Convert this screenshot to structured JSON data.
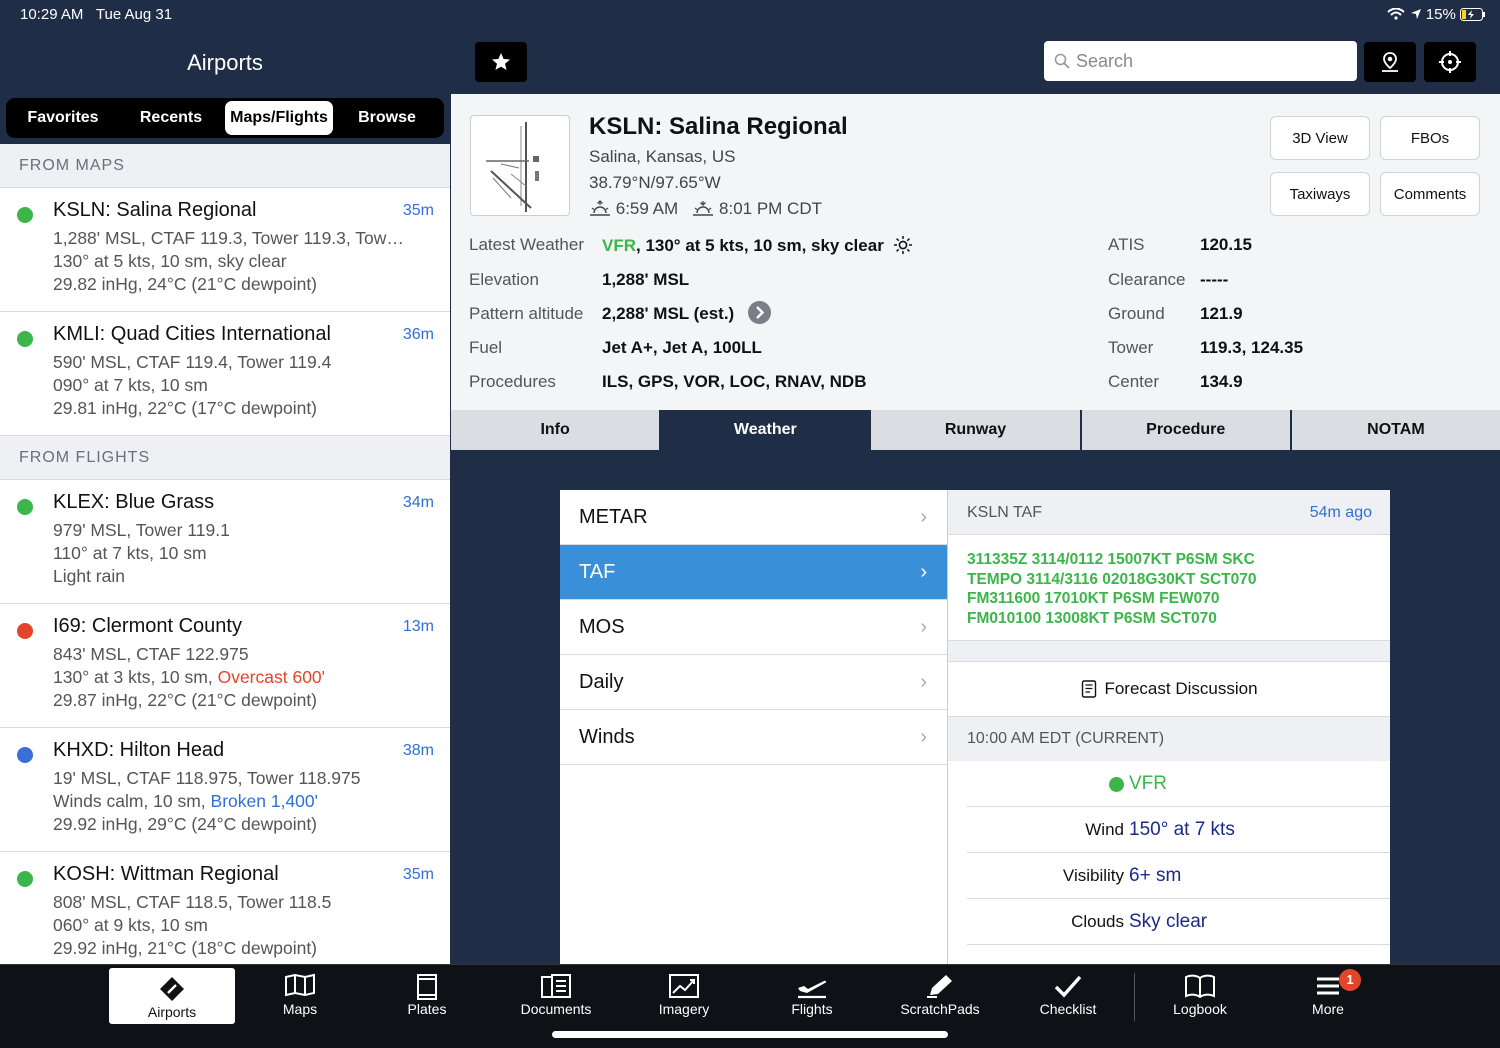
{
  "status": {
    "time": "10:29 AM",
    "date": "Tue Aug 31",
    "battery": "15%"
  },
  "left": {
    "title": "Airports",
    "segments": [
      "Favorites",
      "Recents",
      "Maps/Flights",
      "Browse"
    ],
    "section_maps": "FROM MAPS",
    "section_flights": "FROM FLIGHTS",
    "maps_airports": [
      {
        "name": "KSLN: Salina Regional",
        "age": "35m",
        "line1": "1,288' MSL, CTAF 119.3, Tower 119.3, Tow…",
        "line2": "130° at 5 kts, 10 sm, sky clear",
        "line3": "29.82 inHg, 24°C (21°C dewpoint)",
        "color": "#3cb64a"
      },
      {
        "name": "KMLI: Quad Cities International",
        "age": "36m",
        "line1": "590' MSL, CTAF 119.4, Tower 119.4",
        "line2": "090° at 7 kts, 10 sm",
        "line3": "29.81 inHg, 22°C (17°C dewpoint)",
        "color": "#3cb64a"
      }
    ],
    "flights_airports": [
      {
        "name": "KLEX: Blue Grass",
        "age": "34m",
        "line1": "979' MSL, Tower 119.1",
        "line2": "110° at 7 kts, 10 sm",
        "line3": "Light rain",
        "color": "#3cb64a"
      },
      {
        "name": "I69: Clermont County",
        "age": "13m",
        "line1": "843' MSL, CTAF 122.975",
        "line2a": "130° at 3 kts, 10 sm, ",
        "line2b": "Overcast 600'",
        "line3": "29.87 inHg, 22°C (21°C dewpoint)",
        "color": "#e2452b"
      },
      {
        "name": "KHXD: Hilton Head",
        "age": "38m",
        "line1": "19' MSL, CTAF 118.975, Tower 118.975",
        "line2a": "Winds calm, 10 sm, ",
        "line2b": "Broken 1,400'",
        "line3": "29.92 inHg, 29°C (24°C dewpoint)",
        "color": "#3a6fd8"
      },
      {
        "name": "KOSH: Wittman Regional",
        "age": "35m",
        "line1": "808' MSL, CTAF 118.5, Tower 118.5",
        "line2": "060° at 9 kts, 10 sm",
        "line3": "29.92 inHg, 21°C (18°C dewpoint)",
        "color": "#3cb64a"
      }
    ]
  },
  "header": {
    "search_placeholder": "Search",
    "star_icon": "star-icon",
    "pin_icon": "map-pin-icon",
    "locate_icon": "crosshair-icon"
  },
  "airport": {
    "title": "KSLN: Salina Regional",
    "location": "Salina, Kansas, US",
    "coords": "38.79°N/97.65°W",
    "sunrise": "6:59 AM",
    "sunset": "8:01 PM CDT",
    "buttons": {
      "view3d": "3D View",
      "fbos": "FBOs",
      "taxiways": "Taxiways",
      "comments": "Comments"
    },
    "weather_label": "Latest Weather",
    "weather_cat": "VFR",
    "weather_text": ", 130° at 5 kts, 10 sm, sky clear",
    "elev_label": "Elevation",
    "elev": "1,288' MSL",
    "pattern_label": "Pattern altitude",
    "pattern": "2,288' MSL (est.)",
    "fuel_label": "Fuel",
    "fuel": "Jet A+, Jet A, 100LL",
    "proc_label": "Procedures",
    "proc": "ILS, GPS, VOR, LOC, RNAV, NDB",
    "freqs": [
      {
        "k": "ATIS",
        "v": "120.15"
      },
      {
        "k": "Clearance",
        "v": "-----"
      },
      {
        "k": "Ground",
        "v": "121.9"
      },
      {
        "k": "Tower",
        "v": "119.3, 124.35"
      },
      {
        "k": "Center",
        "v": "134.9"
      }
    ]
  },
  "tabs": [
    "Info",
    "Weather",
    "Runway",
    "Procedure",
    "NOTAM"
  ],
  "wx_menu": [
    "METAR",
    "TAF",
    "MOS",
    "Daily",
    "Winds"
  ],
  "taf": {
    "title": "KSLN TAF",
    "age": "54m ago",
    "lines": [
      "311335Z 3114/0112 15007KT P6SM SKC",
      "TEMPO 3114/3116 02018G30KT SCT070",
      "FM311600 17010KT P6SM FEW070",
      "FM010100 13008KT P6SM SCT070"
    ],
    "forecast_discussion": "Forecast Discussion",
    "current_head": "10:00 AM EDT (CURRENT)",
    "cat": "VFR",
    "rows": [
      {
        "k": "Wind",
        "v": "150° at 7 kts"
      },
      {
        "k": "Visibility",
        "v": "6+ sm"
      },
      {
        "k": "Clouds",
        "v": "Sky clear"
      }
    ]
  },
  "tabbar": [
    {
      "label": "Airports"
    },
    {
      "label": "Maps"
    },
    {
      "label": "Plates"
    },
    {
      "label": "Documents"
    },
    {
      "label": "Imagery"
    },
    {
      "label": "Flights"
    },
    {
      "label": "ScratchPads"
    },
    {
      "label": "Checklist"
    },
    {
      "label": "Logbook"
    },
    {
      "label": "More",
      "badge": "1"
    }
  ]
}
